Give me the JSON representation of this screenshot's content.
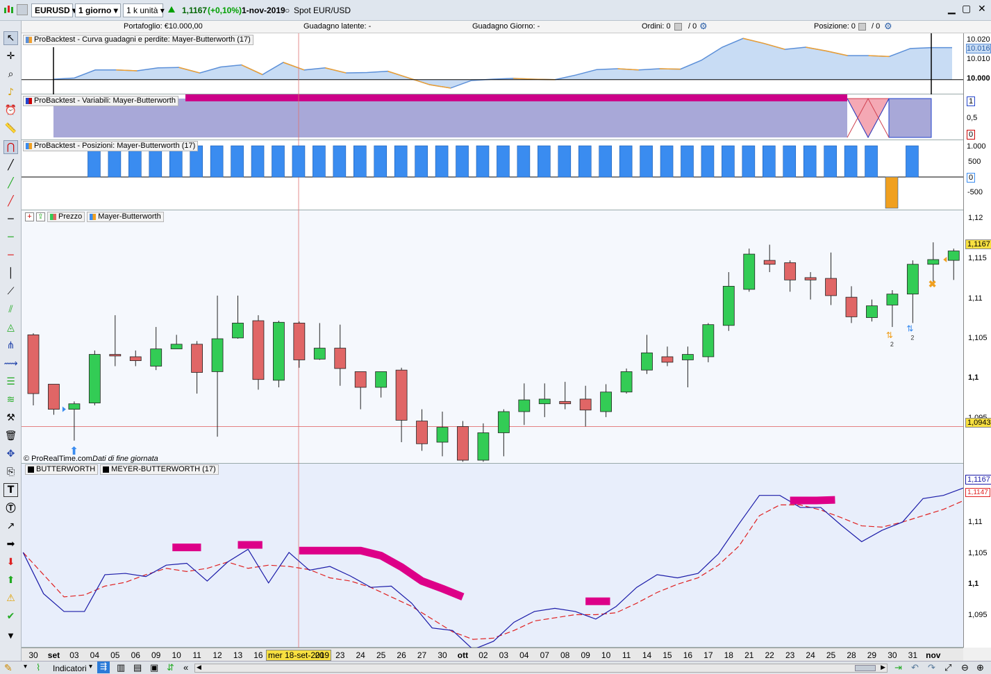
{
  "toolbar": {
    "symbol": "EURUSD",
    "timeframe": "1 giorno",
    "units": "1 k unità",
    "last_price": "1,1167",
    "change": "(+0,10%)",
    "date": "1-nov-2019",
    "spot_label": "Spot EUR/USD",
    "colors": {
      "up": "#00a000",
      "down": "#d40000"
    }
  },
  "infobar": {
    "portfolio": "Portafoglio: €10.000,00",
    "latent_gain": "Guadagno latente:  -",
    "daily_gain": "Guadagno Giorno:  -",
    "orders": "Ordini: 0",
    "orders_b": "/ 0",
    "position": "Posizione: 0",
    "position_b": "/ 0"
  },
  "panels": {
    "equity": {
      "label": "ProBacktest - Curva guadagni e perdite: Mayer-Butterworth (17)",
      "ticks": [
        "10.020",
        "10.016",
        "10.010",
        "10.000"
      ],
      "values": [
        10000.1,
        10000.4,
        10002.3,
        10002.3,
        10002.1,
        10002.8,
        10002.9,
        10001.6,
        10003.0,
        10003.5,
        10001.2,
        10004.1,
        10002.3,
        10002.8,
        10001.6,
        10001.7,
        10002.0,
        10000.4,
        9998.8,
        9998.0,
        9999.8,
        10000.1,
        10000.3,
        10000.1,
        10000.0,
        10001.1,
        10002.4,
        10002.6,
        10002.3,
        10002.6,
        10002.5,
        10004.6,
        10007.7,
        10009.8,
        10008.6,
        10007.2,
        10007.7,
        10006.8,
        10005.7,
        10005.7,
        10005.5,
        10007.4,
        10007.6,
        10007.6
      ],
      "colors": {
        "line": "#5b8fd8",
        "fill": "#c8dcf4",
        "loss": "#f0a030"
      }
    },
    "variables": {
      "label": "ProBacktest - Variabili: Mayer-Butterworth",
      "ticks": [
        "1",
        "0,5",
        "0"
      ],
      "colors": {
        "bar": "#cc0088",
        "fill": "#a8a8d8"
      }
    },
    "positions": {
      "label": "ProBacktest - Posizioni: Mayer-Butterworth (17)",
      "ticks": [
        "1.000",
        "500",
        "0",
        "-500"
      ],
      "values": [
        0,
        1000,
        1000,
        1000,
        1000,
        1000,
        1000,
        1000,
        1000,
        1000,
        1000,
        1000,
        1000,
        1000,
        1000,
        1000,
        1000,
        1000,
        1000,
        1000,
        1000,
        1000,
        1000,
        1000,
        1000,
        1000,
        1000,
        1000,
        1000,
        1000,
        1000,
        1000,
        1000,
        1000,
        1000,
        1000,
        1000,
        1000,
        1000,
        1000,
        -1000,
        1000,
        0,
        0
      ],
      "colors": {
        "long": "#3a8cf0",
        "short": "#f0a020"
      }
    },
    "price": {
      "label_a": "Prezzo",
      "label_b": "Mayer-Butterworth",
      "watermark": "© ProRealTime.com",
      "watermark_b": "Dati di fine giornata",
      "ticks": [
        "1,12",
        "1,115",
        "1,11",
        "1,105",
        "1,1",
        "1,095"
      ],
      "current": "1,1167",
      "crosshair": "1,0943",
      "signal_count": "2",
      "colors": {
        "up": "#33cc55",
        "down": "#e06666"
      }
    },
    "indicator": {
      "label_a": "BUTTERWORTH",
      "label_b": "MEYER-BUTTERWORTH (17)",
      "ticks": [
        "1,11",
        "1,105",
        "1,1",
        "1,095"
      ],
      "value_a": "1,1167",
      "value_b": "1,1147",
      "colors": {
        "line": "#1a1aa8",
        "dashed": "#e02020",
        "mark": "#dd0088"
      }
    }
  },
  "chart_data": {
    "type": "candlestick",
    "categories": [
      "30",
      "set",
      "03",
      "04",
      "05",
      "06",
      "09",
      "10",
      "11",
      "12",
      "13",
      "16",
      "17",
      "18",
      "19",
      "20",
      "23",
      "24",
      "25",
      "26",
      "27",
      "30",
      "ott",
      "02",
      "03",
      "04",
      "07",
      "08",
      "09",
      "10",
      "11",
      "14",
      "15",
      "16",
      "17",
      "18",
      "21",
      "22",
      "23",
      "24",
      "25",
      "28",
      "29",
      "30",
      "31",
      "nov"
    ],
    "ohlc": [
      [
        1.106,
        1.1062,
        1.097,
        1.0985
      ],
      [
        1.0997,
        1.0997,
        1.0958,
        1.0965
      ],
      [
        1.0965,
        1.0975,
        1.0925,
        1.0972
      ],
      [
        1.0973,
        1.104,
        1.097,
        1.1035
      ],
      [
        1.1035,
        1.1085,
        1.102,
        1.1033
      ],
      [
        1.1032,
        1.104,
        1.102,
        1.1027
      ],
      [
        1.102,
        1.107,
        1.1015,
        1.1042
      ],
      [
        1.1042,
        1.106,
        1.1042,
        1.1048
      ],
      [
        1.1048,
        1.1052,
        1.0985,
        1.1012
      ],
      [
        1.1013,
        1.111,
        1.093,
        1.1055
      ],
      [
        1.1056,
        1.111,
        1.1055,
        1.1075
      ],
      [
        1.1078,
        1.1085,
        1.099,
        1.1003
      ],
      [
        1.1002,
        1.1078,
        1.0993,
        1.1076
      ],
      [
        1.1075,
        1.1077,
        1.1018,
        1.1028
      ],
      [
        1.1029,
        1.1075,
        1.1028,
        1.1043
      ],
      [
        1.1043,
        1.1073,
        1.0995,
        1.1017
      ],
      [
        1.1013,
        1.1013,
        1.0965,
        1.0993
      ],
      [
        1.0993,
        1.1013,
        1.098,
        1.1013
      ],
      [
        1.1015,
        1.1018,
        1.0923,
        1.0951
      ],
      [
        1.095,
        1.0965,
        1.0912,
        1.0921
      ],
      [
        1.0923,
        1.0962,
        1.0905,
        1.0942
      ],
      [
        1.0943,
        1.095,
        1.0898,
        1.09
      ],
      [
        1.09,
        1.0947,
        1.0898,
        1.0935
      ],
      [
        1.0935,
        1.0965,
        1.0905,
        1.0962
      ],
      [
        1.0962,
        1.0998,
        1.0945,
        1.0977
      ],
      [
        1.0972,
        1.0998,
        1.0955,
        1.0978
      ],
      [
        1.0975,
        1.1,
        1.0965,
        1.0972
      ],
      [
        1.0978,
        1.0995,
        1.0943,
        1.0964
      ],
      [
        1.0962,
        1.0997,
        1.0955,
        1.0987
      ],
      [
        1.0987,
        1.1017,
        1.0985,
        1.1013
      ],
      [
        1.1015,
        1.106,
        1.101,
        1.1037
      ],
      [
        1.1032,
        1.1045,
        1.102,
        1.1025
      ],
      [
        1.1028,
        1.1045,
        1.0993,
        1.1035
      ],
      [
        1.1032,
        1.1075,
        1.1025,
        1.1073
      ],
      [
        1.1072,
        1.114,
        1.1065,
        1.1122
      ],
      [
        1.1118,
        1.117,
        1.1115,
        1.1163
      ],
      [
        1.1155,
        1.1175,
        1.114,
        1.115
      ],
      [
        1.1152,
        1.1155,
        1.1115,
        1.113
      ],
      [
        1.1133,
        1.114,
        1.1105,
        1.113
      ],
      [
        1.1132,
        1.1165,
        1.1098,
        1.111
      ],
      [
        1.1108,
        1.1122,
        1.1075,
        1.1083
      ],
      [
        1.1082,
        1.1105,
        1.1077,
        1.1097
      ],
      [
        1.1098,
        1.1117,
        1.107,
        1.1112
      ],
      [
        1.1112,
        1.1155,
        1.1075,
        1.115
      ],
      [
        1.115,
        1.1178,
        1.1125,
        1.1156
      ],
      [
        1.1155,
        1.117,
        1.113,
        1.1167
      ]
    ],
    "butterworth": [
      1.1065,
      1.1,
      1.0972,
      1.0972,
      1.103,
      1.1032,
      1.1027,
      1.1045,
      1.1048,
      1.102,
      1.105,
      1.107,
      1.1017,
      1.1065,
      1.1037,
      1.1043,
      1.1028,
      1.101,
      1.1012,
      1.0985,
      1.0946,
      1.0942,
      1.0912,
      1.0925,
      1.0955,
      1.0972,
      1.0977,
      1.0972,
      1.096,
      1.098,
      1.101,
      1.103,
      1.1025,
      1.1032,
      1.1063,
      1.111,
      1.1155,
      1.1155,
      1.1136,
      1.1136,
      1.1108,
      1.1082,
      1.11,
      1.1113,
      1.115,
      1.1155,
      1.1167
    ],
    "meyer_butterworth": [
      1.1065,
      1.103,
      1.0995,
      1.0998,
      1.1012,
      1.1018,
      1.103,
      1.104,
      1.1035,
      1.104,
      1.105,
      1.104,
      1.1045,
      1.1043,
      1.1038,
      1.1025,
      1.102,
      1.101,
      1.0995,
      1.098,
      1.096,
      1.094,
      1.0928,
      1.093,
      1.0942,
      1.0957,
      1.0962,
      1.0967,
      1.0967,
      1.097,
      1.0985,
      1.1002,
      1.1015,
      1.1025,
      1.1045,
      1.1075,
      1.1123,
      1.114,
      1.114,
      1.1132,
      1.112,
      1.1107,
      1.1105,
      1.1113,
      1.1123,
      1.1133,
      1.1147
    ],
    "ylim": [
      1.09,
      1.121
    ]
  },
  "xaxis": {
    "labels": [
      "30",
      "set",
      "03",
      "04",
      "05",
      "06",
      "09",
      "10",
      "11",
      "12",
      "13",
      "16",
      "mer 18-set-2019",
      "20",
      "23",
      "24",
      "25",
      "26",
      "27",
      "30",
      "ott",
      "02",
      "03",
      "04",
      "07",
      "08",
      "09",
      "10",
      "11",
      "14",
      "15",
      "16",
      "17",
      "18",
      "21",
      "22",
      "23",
      "24",
      "25",
      "28",
      "29",
      "30",
      "31",
      "nov"
    ]
  },
  "bottombar": {
    "indicators": "Indicatori"
  }
}
